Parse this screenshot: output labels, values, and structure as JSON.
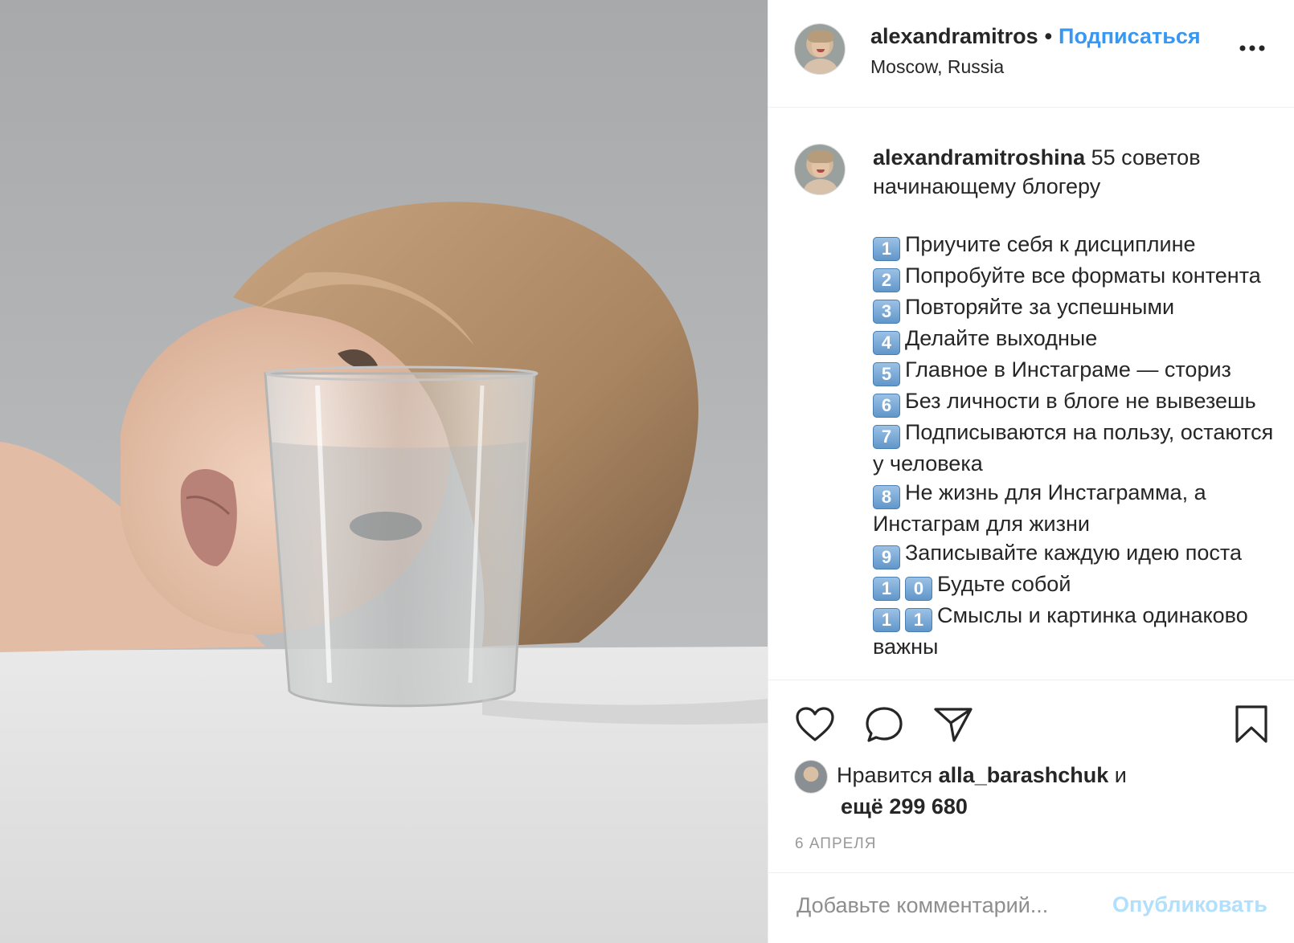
{
  "header": {
    "username": "alexandramitros",
    "separator": "•",
    "follow_label": "Подписаться",
    "location": "Moscow, Russia"
  },
  "caption": {
    "username": "alexandramitroshina",
    "intro": "55 советов начинающему блогеру",
    "tips": [
      {
        "num": [
          "1"
        ],
        "text": "Приучите себя к дисциплине"
      },
      {
        "num": [
          "2"
        ],
        "text": "Попробуйте все форматы контента"
      },
      {
        "num": [
          "3"
        ],
        "text": "Повторяйте за успешными"
      },
      {
        "num": [
          "4"
        ],
        "text": "Делайте выходные"
      },
      {
        "num": [
          "5"
        ],
        "text": "Главное в Инстаграме — сториз"
      },
      {
        "num": [
          "6"
        ],
        "text": "Без личности в блоге не вывезешь"
      },
      {
        "num": [
          "7"
        ],
        "text": "Подписываются на пользу, остаются у человека"
      },
      {
        "num": [
          "8"
        ],
        "text": "Не жизнь для Инстаграмма, а Инстаграм для жизни"
      },
      {
        "num": [
          "9"
        ],
        "text": "Записывайте каждую идею поста"
      },
      {
        "num": [
          "1",
          "0"
        ],
        "text": "Будьте собой"
      },
      {
        "num": [
          "1",
          "1"
        ],
        "text": "Смыслы и картинка одинаково важны"
      }
    ]
  },
  "likes": {
    "prefix": "Нравится",
    "user": "alla_barashchuk",
    "conj": "и",
    "others": "ещё 299 680"
  },
  "date": "6 АПРЕЛЯ",
  "comment": {
    "placeholder": "Добавьте комментарий...",
    "publish_label": "Опубликовать"
  },
  "icons": [
    "heart-icon",
    "comment-icon",
    "share-icon",
    "bookmark-icon",
    "more-icon"
  ]
}
